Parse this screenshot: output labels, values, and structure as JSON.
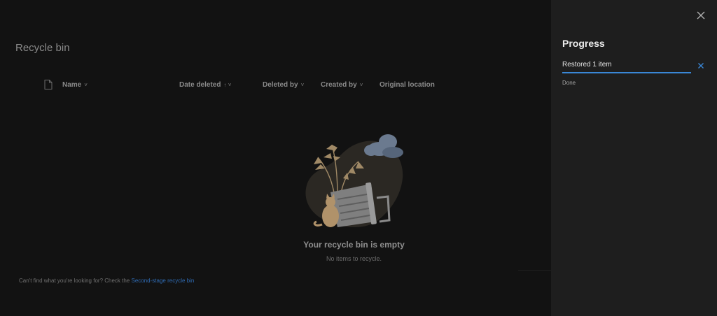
{
  "main": {
    "title": "Recycle bin",
    "columns": [
      {
        "label": "Name",
        "indicator": "˅"
      },
      {
        "label": "Date deleted",
        "indicator": "↑ ˅"
      },
      {
        "label": "Deleted by",
        "indicator": "˅"
      },
      {
        "label": "Created by",
        "indicator": "˅"
      },
      {
        "label": "Original location",
        "indicator": ""
      }
    ],
    "empty_state": {
      "title": "Your recycle bin is empty",
      "subtitle": "No items to recycle."
    },
    "footer": {
      "text": "Can't find what you're looking for? Check the ",
      "link": "Second-stage recycle bin"
    }
  },
  "panel": {
    "title": "Progress",
    "items": [
      {
        "label": "Restored 1 item",
        "progress": 1.0,
        "status": "Done"
      }
    ]
  },
  "colors": {
    "accent": "#3a87d6",
    "link": "#2f6bb3",
    "panel_bg": "#1e1e1e",
    "main_bg": "#121212"
  },
  "icons": {
    "file": "file-icon",
    "close": "close-icon",
    "dismiss": "dismiss-icon"
  }
}
